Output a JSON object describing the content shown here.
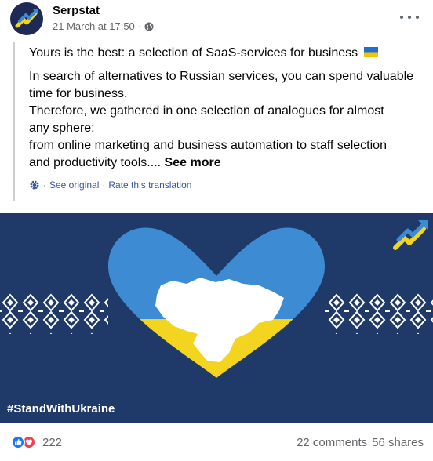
{
  "post": {
    "page_name": "Serpstat",
    "timestamp": "21 March at 17:50",
    "separator": "·",
    "title": "Yours is the best: a selection of SaaS-services for business",
    "paragraph_lines": [
      "In search of alternatives to Russian services, you can spend valuable",
      "time for business.",
      "Therefore, we gathered in one selection of analogues for almost",
      "any sphere:",
      "from online marketing and business automation to staff selection",
      "and productivity tools...."
    ],
    "see_more": "See more",
    "see_original": "See original",
    "rate_translation": "Rate this translation",
    "translate_sep": "·"
  },
  "image": {
    "hashtag": "#StandWithUkraine",
    "colors": {
      "background": "#1f3a68",
      "blue": "#3d8bd3",
      "yellow": "#f3d41e"
    }
  },
  "footer": {
    "reaction_count": "222",
    "comments": "22 comments",
    "shares": "56 shares"
  },
  "icons": [
    "serpstat-logo-icon",
    "globe-icon",
    "more-icon",
    "gear-icon",
    "ukraine-flag-icon",
    "like-icon",
    "love-icon"
  ]
}
